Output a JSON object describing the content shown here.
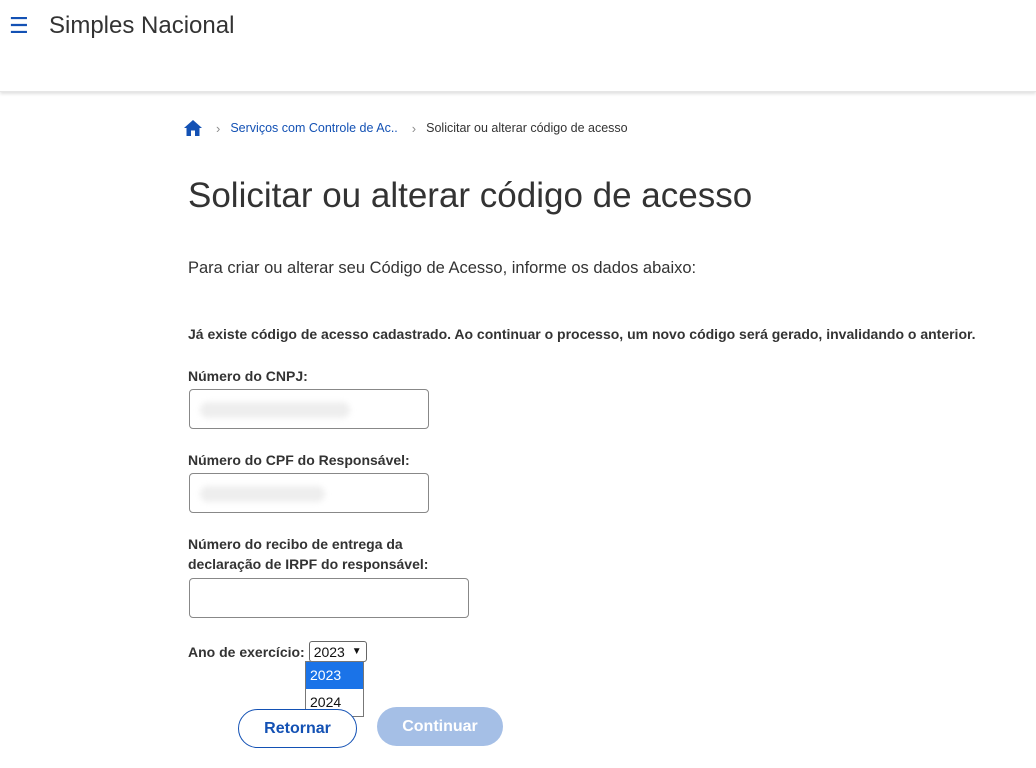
{
  "header": {
    "menu_icon": "hamburger-menu-icon",
    "title": "Simples Nacional"
  },
  "breadcrumb": {
    "home_icon": "home-icon",
    "items": [
      {
        "label": "Serviços com Controle de Ac..",
        "link": true
      },
      {
        "label": "Solicitar ou alterar código de acesso",
        "link": false
      }
    ]
  },
  "page": {
    "title": "Solicitar ou alterar código de acesso",
    "intro": "Para criar ou alterar seu Código de Acesso, informe os dados abaixo:",
    "notice": "Já existe código de acesso cadastrado. Ao continuar o processo, um novo código será gerado, invalidando o anterior."
  },
  "form": {
    "cnpj_label": "Número do CNPJ:",
    "cpf_label": "Número do CPF do Responsável:",
    "receipt_label_line1": "Número do recibo de entrega da",
    "receipt_label_line2": "declaração de IRPF do responsável:",
    "receipt_value": "",
    "year_label": "Ano de exercício:",
    "year_selected": "2023",
    "year_options": [
      "2023",
      "2024"
    ],
    "back_button": "Retornar",
    "continue_button": "Continuar"
  },
  "colors": {
    "primary": "#1351b4",
    "disabled_button": "#a5bfe6",
    "dropdown_highlight": "#1a73e8"
  }
}
